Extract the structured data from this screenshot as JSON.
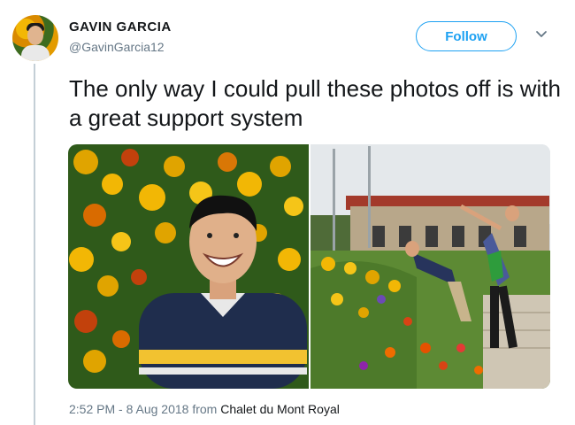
{
  "user": {
    "name": "GAVIN GARCIA",
    "handle": "@GavinGarcia12"
  },
  "actions": {
    "follow_label": "Follow"
  },
  "tweet": {
    "text": "The only way I could pull these photos off is with a great support system"
  },
  "meta": {
    "time": "2:52 PM - 8 Aug 2018",
    "from_word": "from",
    "source": "Chalet du Mont Royal"
  },
  "colors": {
    "accent": "#1da1f2",
    "muted": "#657786",
    "text": "#14171a"
  },
  "icons": {
    "caret": "chevron-down-icon"
  }
}
